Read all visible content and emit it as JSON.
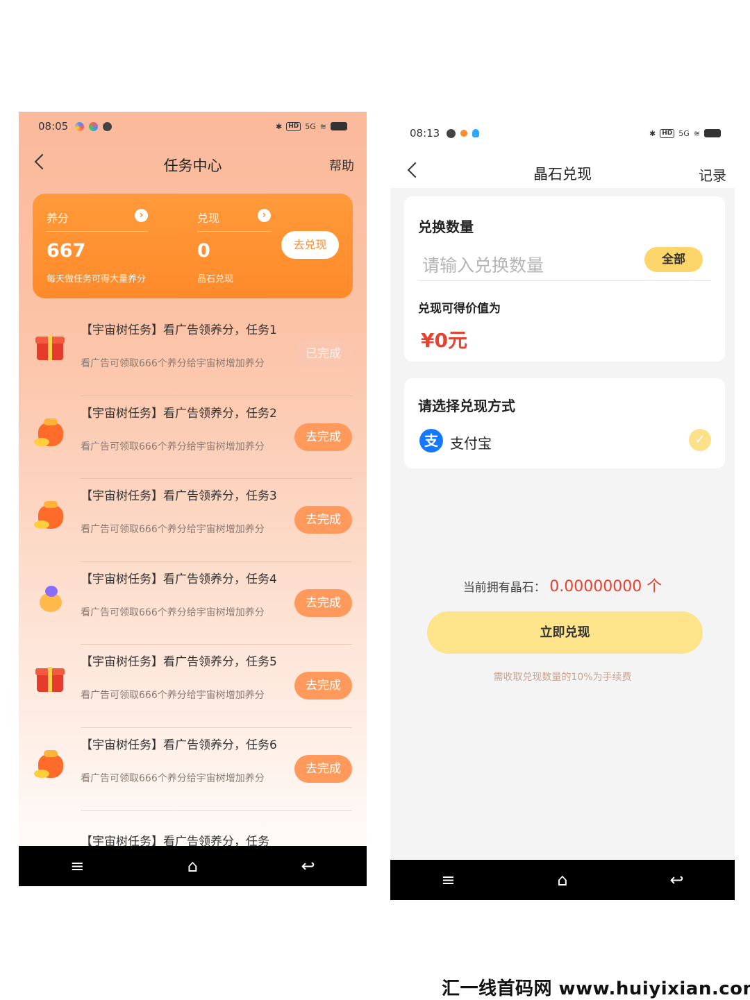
{
  "left": {
    "status": {
      "time": "08:05",
      "hd": "HD",
      "signal": "5G"
    },
    "nav": {
      "title": "任务中心",
      "right": "帮助"
    },
    "card": {
      "points_label": "养分",
      "points_value": "667",
      "points_sub": "每天做任务可得大量养分",
      "cash_label": "兑现",
      "cash_value": "0",
      "cash_sub": "晶石兑现",
      "button": "去兑现"
    },
    "tasks": [
      {
        "title": "【宇宙树任务】看广告领养分，任务1",
        "desc": "看广告可领取666个养分给宇宙树增加养分",
        "button": "已完成",
        "icon": "gift-box-icon"
      },
      {
        "title": "【宇宙树任务】看广告领养分，任务2",
        "desc": "看广告可领取666个养分给宇宙树增加养分",
        "button": "去完成",
        "icon": "money-bag-icon"
      },
      {
        "title": "【宇宙树任务】看广告领养分，任务3",
        "desc": "看广告可领取666个养分给宇宙树增加养分",
        "button": "去完成",
        "icon": "money-bag-icon"
      },
      {
        "title": "【宇宙树任务】看广告领养分，任务4",
        "desc": "看广告可领取666个养分给宇宙树增加养分",
        "button": "去完成",
        "icon": "treasure-bag-icon"
      },
      {
        "title": "【宇宙树任务】看广告领养分，任务5",
        "desc": "看广告可领取666个养分给宇宙树增加养分",
        "button": "去完成",
        "icon": "gift-box-icon"
      },
      {
        "title": "【宇宙树任务】看广告领养分，任务6",
        "desc": "看广告可领取666个养分给宇宙树增加养分",
        "button": "去完成",
        "icon": "money-bag-icon"
      },
      {
        "title": "【宇宙树任务】看广告领养分，任务",
        "desc": "",
        "button": "",
        "icon": "coin-stack-icon"
      }
    ],
    "navbar": {
      "menu": "≡",
      "home": "⌂",
      "back": "↩"
    }
  },
  "right": {
    "status": {
      "time": "08:13",
      "hd": "HD",
      "signal": "5G"
    },
    "nav": {
      "title": "晶石兑现",
      "right": "记录"
    },
    "amount": {
      "heading": "兑换数量",
      "placeholder": "请输入兑换数量",
      "all_button": "全部",
      "value_label": "兑现可得价值为",
      "value": "¥0元"
    },
    "method": {
      "heading": "请选择兑现方式",
      "option": "支付宝",
      "option_icon": "支",
      "selected": true
    },
    "balance": {
      "label": "当前拥有晶石：",
      "value": "0.00000000 个"
    },
    "submit": "立即兑现",
    "fee_note": "需收取兑现数量的10%为手续费",
    "navbar": {
      "menu": "≡",
      "home": "⌂",
      "back": "↩"
    }
  },
  "watermark": "汇一线首码网 www.huiyixian.com",
  "colors": {
    "accent_orange": "#ff8a2a",
    "accent_yellow": "#fcd66b",
    "price_red": "#e5432f"
  }
}
